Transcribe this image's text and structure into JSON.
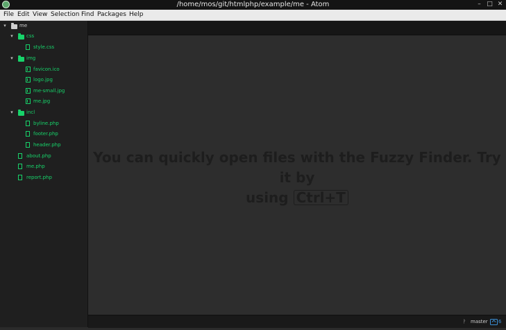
{
  "window": {
    "title": "/home/mos/git/htmlphp/example/me - Atom",
    "minimize_glyph": "–",
    "maximize_glyph": "□",
    "close_glyph": "✕"
  },
  "menu": [
    "File",
    "Edit",
    "View",
    "Selection",
    "Find",
    "Packages",
    "Help"
  ],
  "tree": {
    "root": "me",
    "items": [
      {
        "label": "css",
        "kind": "folder"
      },
      {
        "label": "style.css",
        "kind": "file"
      },
      {
        "label": "img",
        "kind": "folder"
      },
      {
        "label": "favicon.ico",
        "kind": "image"
      },
      {
        "label": "logo.jpg",
        "kind": "image"
      },
      {
        "label": "me-small.jpg",
        "kind": "image"
      },
      {
        "label": "me.jpg",
        "kind": "image"
      },
      {
        "label": "incl",
        "kind": "folder"
      },
      {
        "label": "byline.php",
        "kind": "file"
      },
      {
        "label": "footer.php",
        "kind": "file"
      },
      {
        "label": "header.php",
        "kind": "file"
      },
      {
        "label": "about.php",
        "kind": "file"
      },
      {
        "label": "me.php",
        "kind": "file"
      },
      {
        "label": "report.php",
        "kind": "file"
      }
    ]
  },
  "editor": {
    "hint_line1": "You can quickly open files with the Fuzzy Finder. Try it by",
    "hint_using": "using",
    "hint_key": "Ctrl+T"
  },
  "status": {
    "branch": "master",
    "updates": "6"
  },
  "colors": {
    "accent": "#17d36a",
    "tree_bg": "#1f1f1f",
    "editor_bg": "#2d2d2d"
  }
}
